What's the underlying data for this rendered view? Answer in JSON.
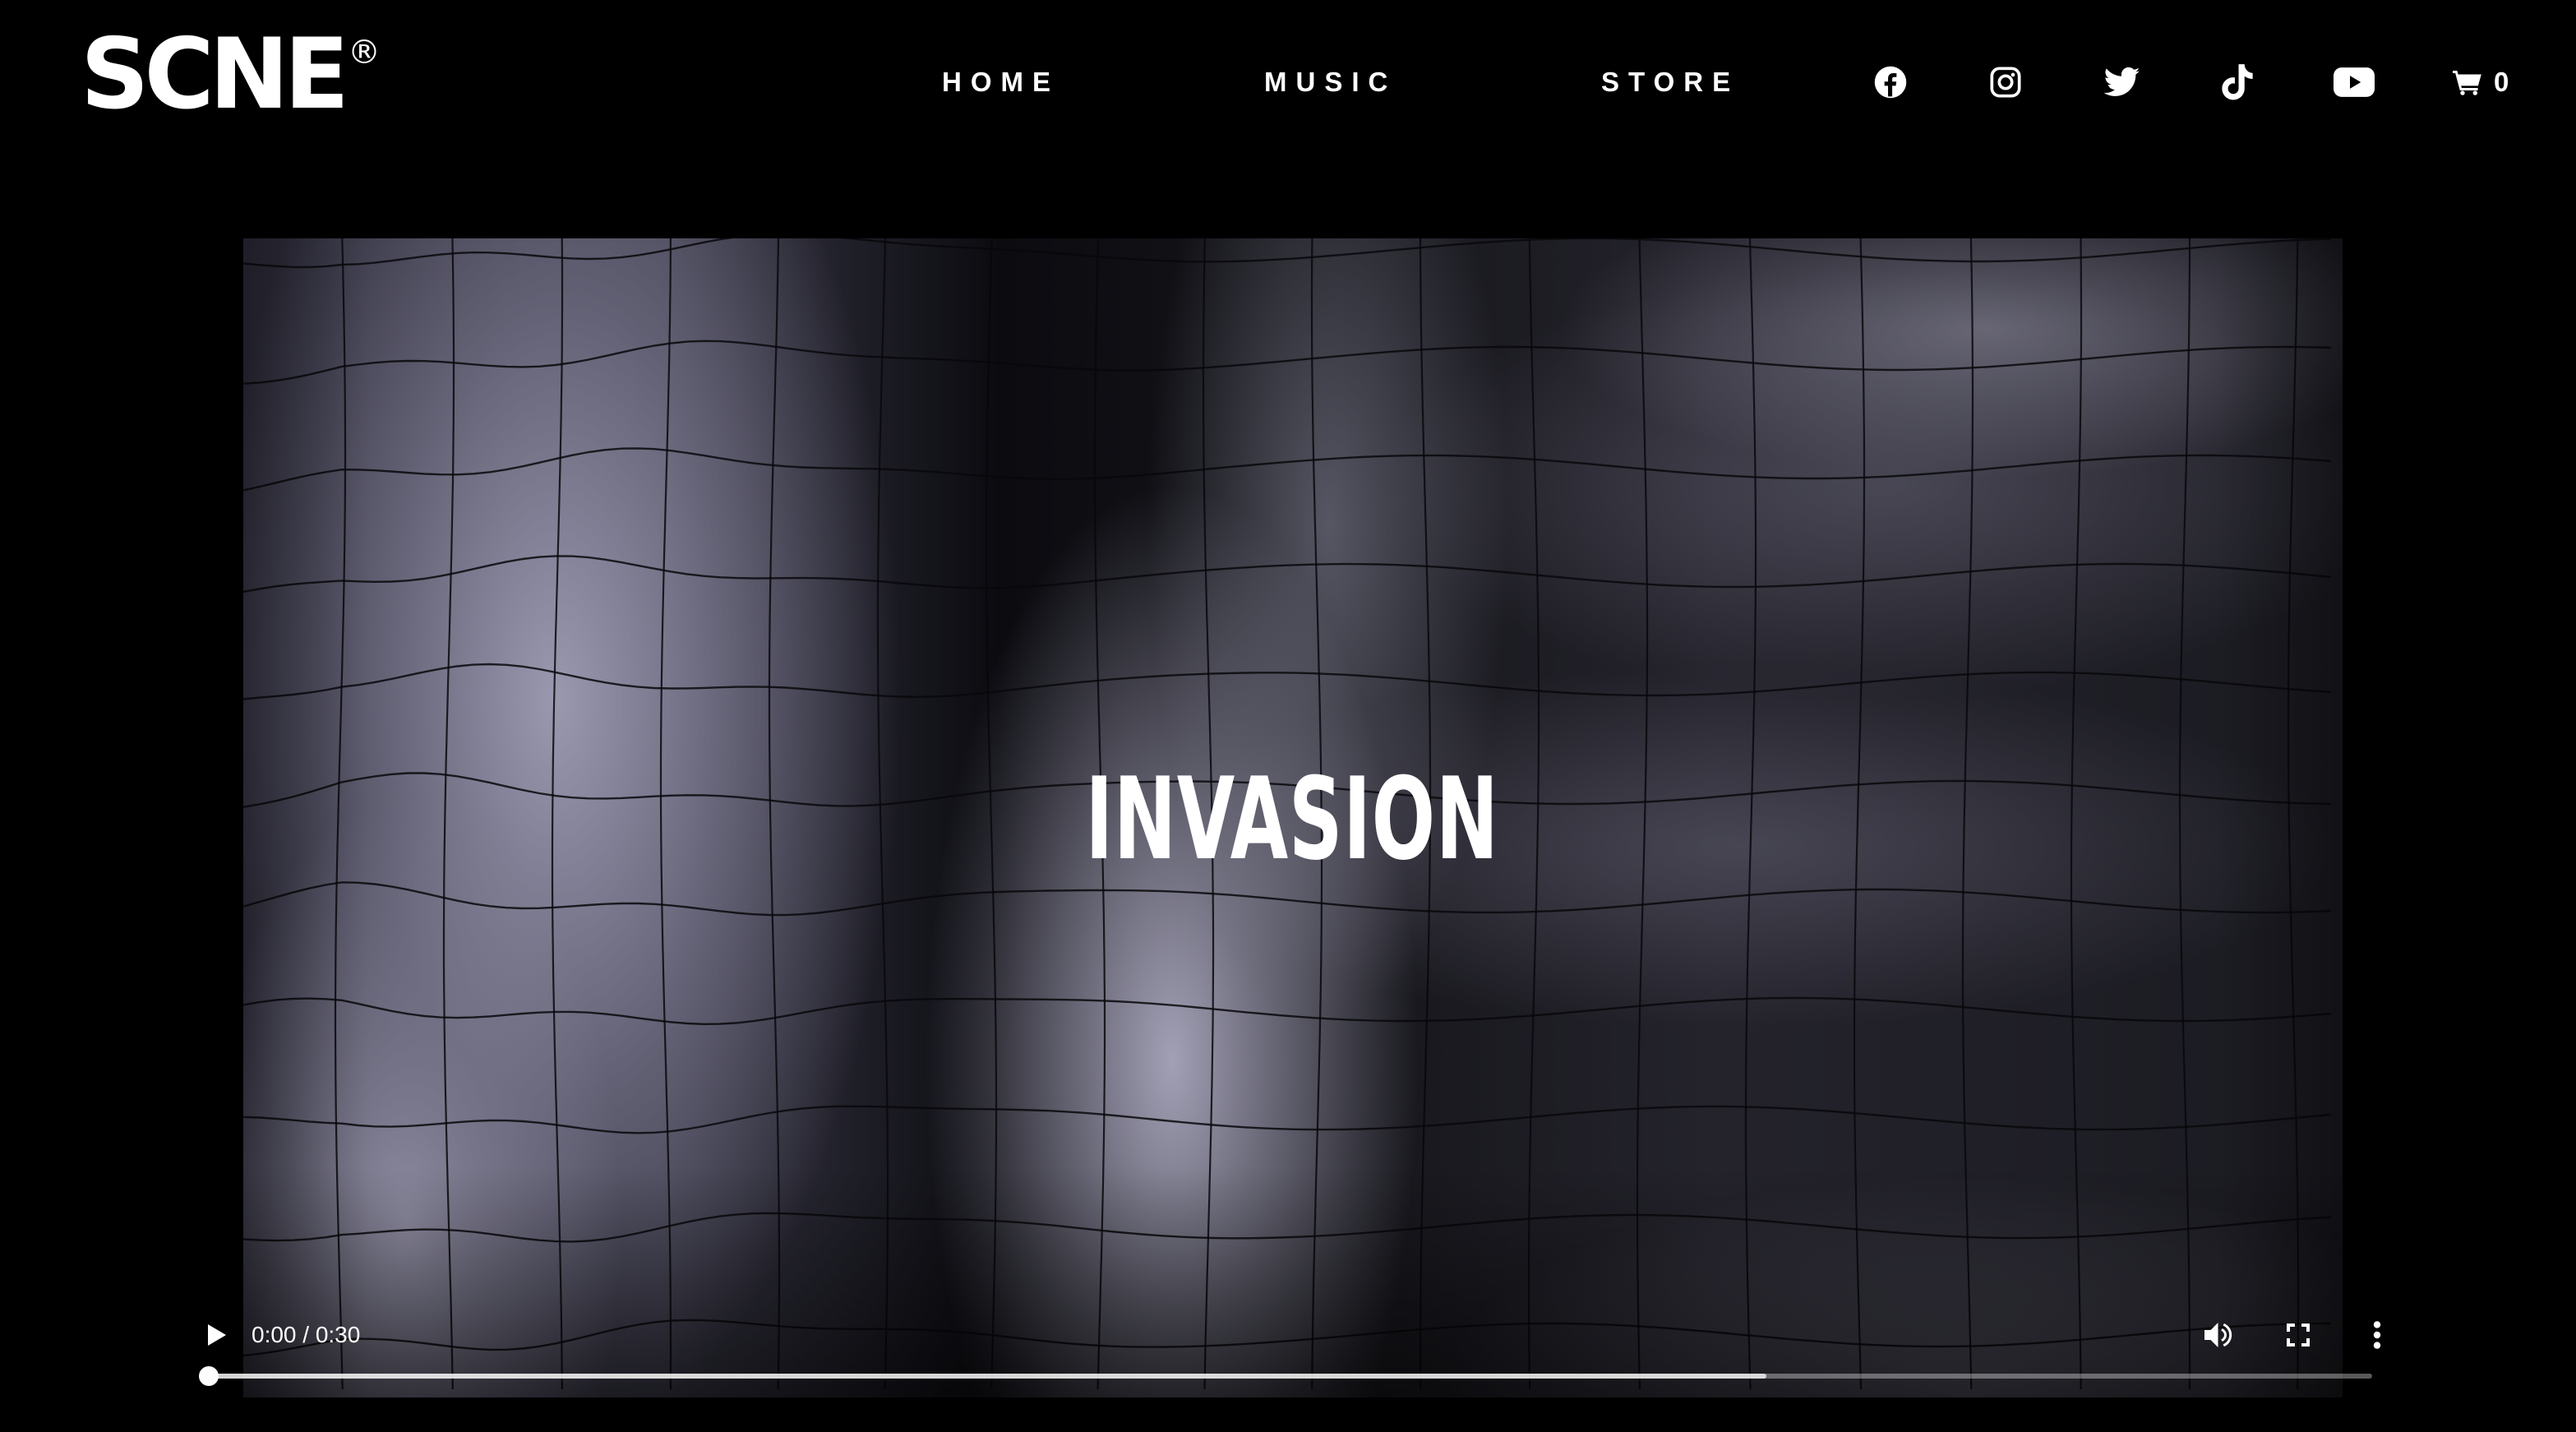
{
  "header": {
    "logo": {
      "text": "SCNE",
      "registered": "®"
    },
    "nav": [
      {
        "label": "HOME"
      },
      {
        "label": "MUSIC"
      },
      {
        "label": "STORE"
      }
    ],
    "social_icons": [
      "facebook-icon",
      "instagram-icon",
      "twitter-icon",
      "tiktok-icon",
      "youtube-icon"
    ],
    "cart": {
      "icon": "cart-icon",
      "count": "0"
    }
  },
  "video": {
    "title": "INVASION",
    "time": "0:00 / 0:30",
    "current_seconds": 0,
    "duration_seconds": 30,
    "buffered_fraction": 0.72,
    "controls": {
      "play_icon": "play-icon",
      "volume_icon": "volume-icon",
      "fullscreen_icon": "fullscreen-icon",
      "more_icon": "more-options-icon"
    }
  },
  "colors": {
    "background": "#000000",
    "text": "#ffffff"
  }
}
